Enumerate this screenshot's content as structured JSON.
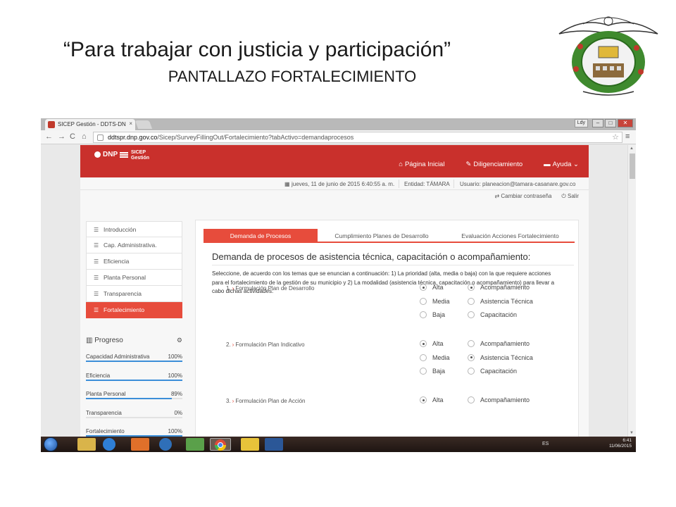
{
  "slide": {
    "title": "“Para trabajar con justicia y participación”",
    "subtitle": "PANTALLAZO FORTALECIMIENTO"
  },
  "browser": {
    "tab_title": "SICEP Gestión - DDTS-DN",
    "tab_close": "×",
    "user_chip": "Ldy",
    "url_host": "ddtspr.dnp.gov.co",
    "url_path": "/Sicep/SurveyFillingOut/Fortalecimiento?tabActivo=demandaprocesos"
  },
  "header": {
    "logo_text": "DNP",
    "product_line1": "SICEP",
    "product_line2": "Gestión",
    "nav": [
      "Página Inicial",
      "Diligenciamiento",
      "Ayuda"
    ],
    "date": "jueves, 11 de junio de 2015 6:40:55 a. m.",
    "entity": "Entidad: TÁMARA",
    "user": "Usuario: planeacion@tamara-casanare.gov.co",
    "change_password": "Cambiar contraseña",
    "logout": "Salir"
  },
  "sidebar": {
    "items": [
      {
        "label": "Introducción",
        "active": false
      },
      {
        "label": "Cap. Administrativa.",
        "active": false
      },
      {
        "label": "Eficiencia",
        "active": false
      },
      {
        "label": "Planta Personal",
        "active": false
      },
      {
        "label": "Transparencia",
        "active": false
      },
      {
        "label": "Fortalecimiento",
        "active": true
      }
    ]
  },
  "progress": {
    "title": "Progreso",
    "rows": [
      {
        "label": "Capacidad Administrativa",
        "pct": "100%",
        "value": 100
      },
      {
        "label": "Eficiencia",
        "pct": "100%",
        "value": 100
      },
      {
        "label": "Planta Personal",
        "pct": "89%",
        "value": 89
      },
      {
        "label": "Transparencia",
        "pct": "0%",
        "value": 0
      },
      {
        "label": "Fortalecimiento",
        "pct": "100%",
        "value": 100
      }
    ]
  },
  "main": {
    "tabs": [
      "Demanda de Procesos",
      "Cumplimiento Planes de Desarrollo",
      "Evaluación Acciones Fortalecimiento"
    ],
    "heading": "Demanda de procesos de asistencia técnica, capacitación o acompañamiento:",
    "instructions": "Seleccione, de acuerdo con los temas que se enuncian a continuación: 1) La prioridad (alta, media o baja) con la que requiere acciones para el fortalecimiento de la gestión de su municipio y 2) La modalidad (asistencia técnica, capacitación o acompañamiento) para llevar a cabo dichas actividades:",
    "questions": [
      {
        "num": "1.",
        "label": "Formulación Plan de Desarrollo",
        "priority": [
          "Alta",
          "Media",
          "Baja"
        ],
        "priority_selected": 0,
        "modality": [
          "Acompañamiento",
          "Asistencia Técnica",
          "Capacitación"
        ],
        "modality_selected": 0
      },
      {
        "num": "2.",
        "label": "Formulación Plan Indicativo",
        "priority": [
          "Alta",
          "Media",
          "Baja"
        ],
        "priority_selected": 0,
        "modality": [
          "Acompañamiento",
          "Asistencia Técnica",
          "Capacitación"
        ],
        "modality_selected": 1
      },
      {
        "num": "3.",
        "label": "Formulación Plan de Acción",
        "priority": [
          "Alta"
        ],
        "priority_selected": 0,
        "modality": [
          "Acompañamiento"
        ],
        "modality_selected": -1
      }
    ]
  },
  "taskbar": {
    "lang": "ES",
    "time": "6:41",
    "date": "11/06/2015"
  }
}
